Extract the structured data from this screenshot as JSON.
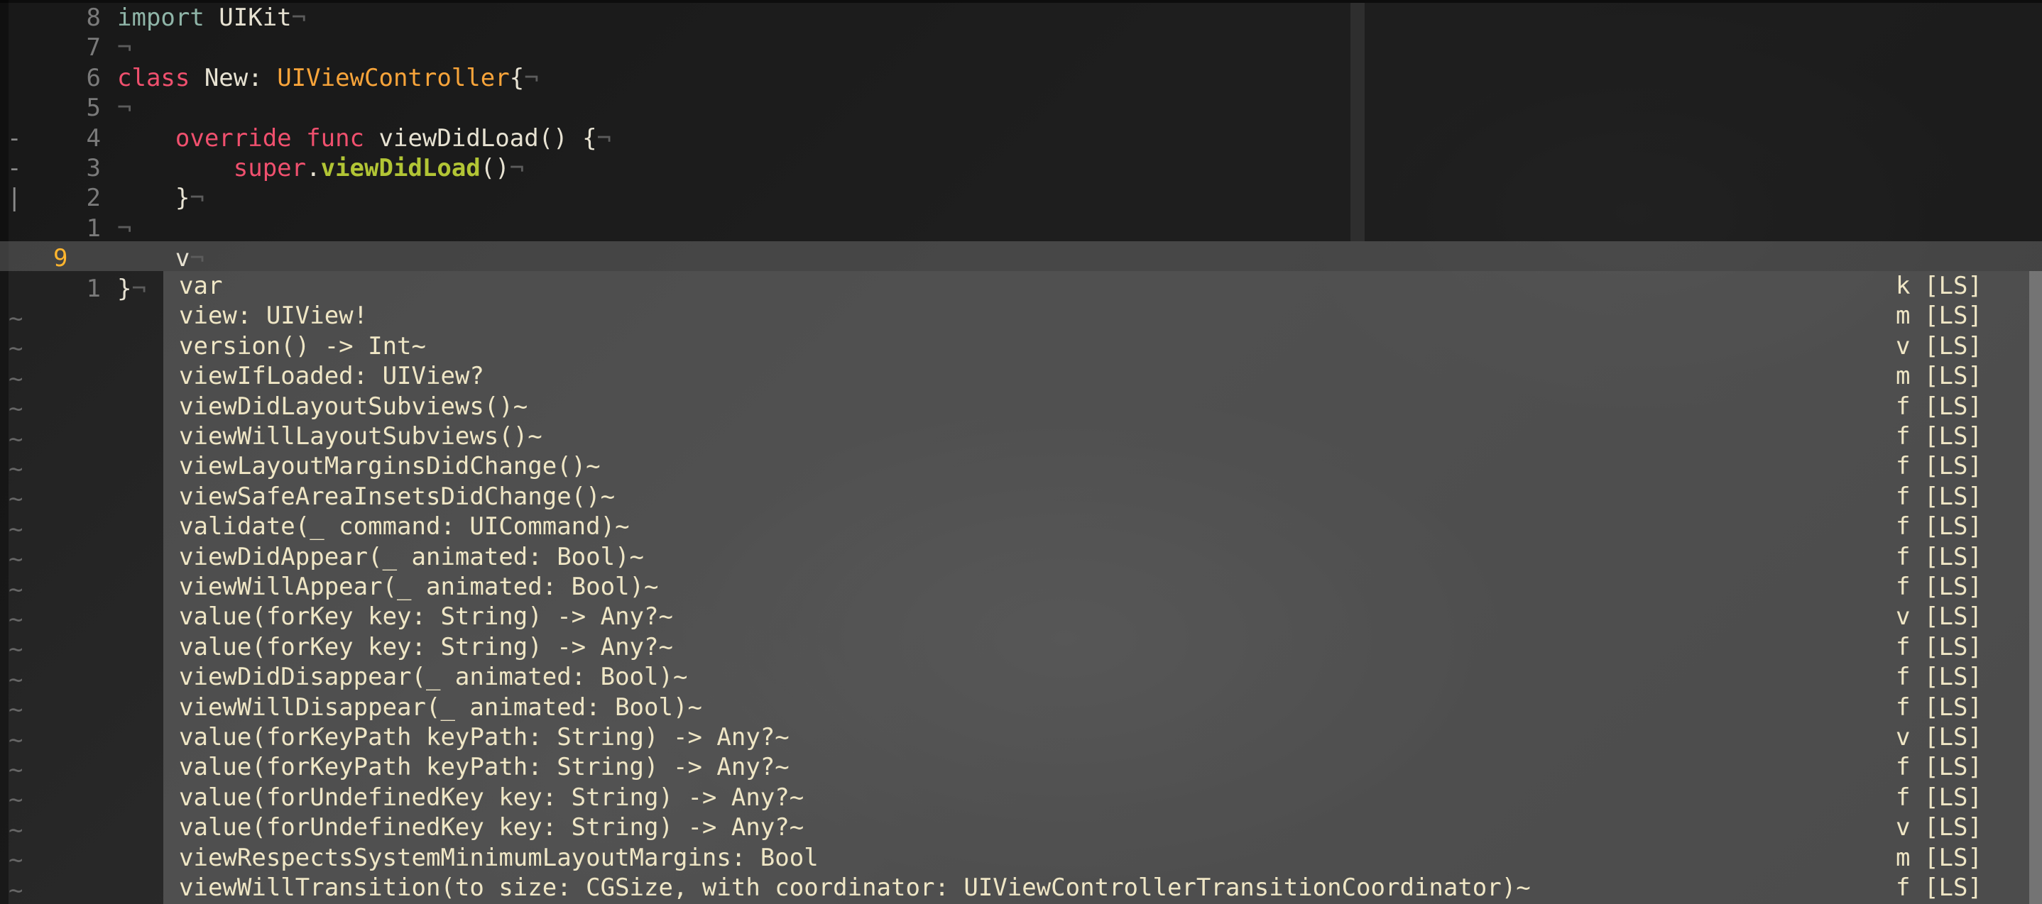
{
  "editor": {
    "lines": [
      {
        "nr": "8",
        "sign": "",
        "parts": [
          {
            "t": "import",
            "c": "kw-blue"
          },
          {
            "t": " UIKit",
            "c": "fn"
          },
          {
            "t": "¬",
            "c": "eol"
          }
        ]
      },
      {
        "nr": "7",
        "sign": "",
        "parts": [
          {
            "t": "¬",
            "c": "eol"
          }
        ]
      },
      {
        "nr": "6",
        "sign": "",
        "parts": [
          {
            "t": "class",
            "c": "kw-red"
          },
          {
            "t": " New: ",
            "c": "fn"
          },
          {
            "t": "UIViewController",
            "c": "type"
          },
          {
            "t": "{",
            "c": "fn"
          },
          {
            "t": "¬",
            "c": "eol"
          }
        ]
      },
      {
        "nr": "5",
        "sign": "",
        "parts": [
          {
            "t": "¬",
            "c": "eol"
          }
        ]
      },
      {
        "nr": "4",
        "sign": "-",
        "parts": [
          {
            "t": "    ",
            "c": "fn"
          },
          {
            "t": "override",
            "c": "kw-red"
          },
          {
            "t": " ",
            "c": "fn"
          },
          {
            "t": "func",
            "c": "kw-red"
          },
          {
            "t": " viewDidLoad() {",
            "c": "fn"
          },
          {
            "t": "¬",
            "c": "eol"
          }
        ]
      },
      {
        "nr": "3",
        "sign": "-",
        "parts": [
          {
            "t": "        ",
            "c": "fn"
          },
          {
            "t": "super",
            "c": "kw-red"
          },
          {
            "t": ".",
            "c": "fn"
          },
          {
            "t": "viewDidLoad",
            "c": "fn-green"
          },
          {
            "t": "()",
            "c": "fn"
          },
          {
            "t": "¬",
            "c": "eol"
          }
        ]
      },
      {
        "nr": "2",
        "sign": "|",
        "parts": [
          {
            "t": "    }",
            "c": "fn"
          },
          {
            "t": "¬",
            "c": "eol"
          }
        ]
      },
      {
        "nr": "1",
        "sign": "",
        "parts": [
          {
            "t": "¬",
            "c": "eol"
          }
        ]
      },
      {
        "nr": "9",
        "sign": "",
        "current": true,
        "parts": [
          {
            "t": "    v",
            "c": "fn"
          },
          {
            "t": "¬",
            "c": "eol"
          }
        ]
      },
      {
        "nr": "1",
        "sign": "",
        "parts": [
          {
            "t": "}",
            "c": "fn"
          },
          {
            "t": "¬",
            "c": "eol"
          }
        ]
      }
    ],
    "tilde": "~"
  },
  "popup": {
    "items": [
      {
        "word": "var",
        "kind": "k",
        "menu": "[LS]"
      },
      {
        "word": "view: UIView!",
        "kind": "m",
        "menu": "[LS]"
      },
      {
        "word": "version() -> Int~",
        "kind": "v",
        "menu": "[LS]"
      },
      {
        "word": "viewIfLoaded: UIView?",
        "kind": "m",
        "menu": "[LS]"
      },
      {
        "word": "viewDidLayoutSubviews()~",
        "kind": "f",
        "menu": "[LS]"
      },
      {
        "word": "viewWillLayoutSubviews()~",
        "kind": "f",
        "menu": "[LS]"
      },
      {
        "word": "viewLayoutMarginsDidChange()~",
        "kind": "f",
        "menu": "[LS]"
      },
      {
        "word": "viewSafeAreaInsetsDidChange()~",
        "kind": "f",
        "menu": "[LS]"
      },
      {
        "word": "validate(_ command: UICommand)~",
        "kind": "f",
        "menu": "[LS]"
      },
      {
        "word": "viewDidAppear(_ animated: Bool)~",
        "kind": "f",
        "menu": "[LS]"
      },
      {
        "word": "viewWillAppear(_ animated: Bool)~",
        "kind": "f",
        "menu": "[LS]"
      },
      {
        "word": "value(forKey key: String) -> Any?~",
        "kind": "v",
        "menu": "[LS]"
      },
      {
        "word": "value(forKey key: String) -> Any?~",
        "kind": "f",
        "menu": "[LS]"
      },
      {
        "word": "viewDidDisappear(_ animated: Bool)~",
        "kind": "f",
        "menu": "[LS]"
      },
      {
        "word": "viewWillDisappear(_ animated: Bool)~",
        "kind": "f",
        "menu": "[LS]"
      },
      {
        "word": "value(forKeyPath keyPath: String) -> Any?~",
        "kind": "v",
        "menu": "[LS]"
      },
      {
        "word": "value(forKeyPath keyPath: String) -> Any?~",
        "kind": "f",
        "menu": "[LS]"
      },
      {
        "word": "value(forUndefinedKey key: String) -> Any?~",
        "kind": "f",
        "menu": "[LS]"
      },
      {
        "word": "value(forUndefinedKey key: String) -> Any?~",
        "kind": "v",
        "menu": "[LS]"
      },
      {
        "word": "viewRespectsSystemMinimumLayoutMargins: Bool",
        "kind": "m",
        "menu": "[LS]"
      },
      {
        "word": "viewWillTransition(to size: CGSize, with coordinator: UIViewControllerTransitionCoordinator)~",
        "kind": "f",
        "menu": "[LS]"
      }
    ]
  },
  "colors": {
    "line_number": "#7a7a7a",
    "current_line_number": "#ffb52e",
    "keyword_red": "#f0506e",
    "keyword_import": "#8fb5a8",
    "type_orange": "#f8a43a",
    "method_green": "#b2c535",
    "popup_text": "#efe6c5"
  }
}
